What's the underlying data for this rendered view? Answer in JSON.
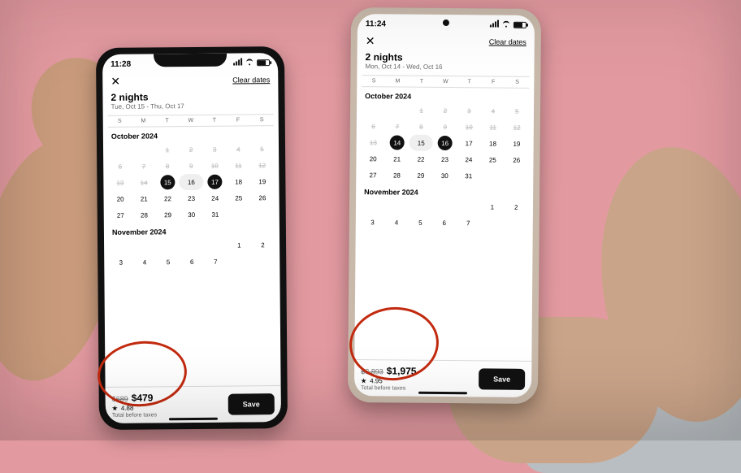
{
  "phones": [
    {
      "key": "left",
      "statusTime": "11:28",
      "header": {
        "clearDates": "Clear dates"
      },
      "title": "2 nights",
      "subtitle": "Tue, Oct 15 - Thu, Oct 17",
      "weekdays": [
        "S",
        "M",
        "T",
        "W",
        "T",
        "F",
        "S"
      ],
      "months": [
        {
          "label": "October 2024",
          "leading": 2,
          "days": 31,
          "selected": [
            15,
            17
          ],
          "range": [
            16
          ],
          "muted": [
            1,
            2,
            3,
            4,
            5,
            6,
            7,
            8,
            9,
            10,
            11,
            12,
            13,
            14
          ]
        },
        {
          "label": "November 2024",
          "leading": 5,
          "days": 7,
          "selected": [],
          "range": [],
          "muted": []
        }
      ],
      "price": {
        "original": "$689",
        "current": "$479",
        "rating": "4.88",
        "totalLabel": "Total before taxes"
      },
      "saveLabel": "Save"
    },
    {
      "key": "right",
      "statusTime": "11:24",
      "header": {
        "clearDates": "Clear dates"
      },
      "title": "2 nights",
      "subtitle": "Mon, Oct 14 - Wed, Oct 16",
      "weekdays": [
        "S",
        "M",
        "T",
        "W",
        "T",
        "F",
        "S"
      ],
      "months": [
        {
          "label": "October 2024",
          "leading": 2,
          "days": 31,
          "selected": [
            14,
            16
          ],
          "range": [
            15
          ],
          "muted": [
            1,
            2,
            3,
            4,
            5,
            6,
            7,
            8,
            9,
            10,
            11,
            12,
            13
          ]
        },
        {
          "label": "November 2024",
          "leading": 5,
          "days": 7,
          "selected": [],
          "range": [],
          "muted": []
        }
      ],
      "price": {
        "original": "$3,893",
        "current": "$1,975",
        "rating": "4.95",
        "totalLabel": "Total before taxes"
      },
      "saveLabel": "Save"
    }
  ]
}
